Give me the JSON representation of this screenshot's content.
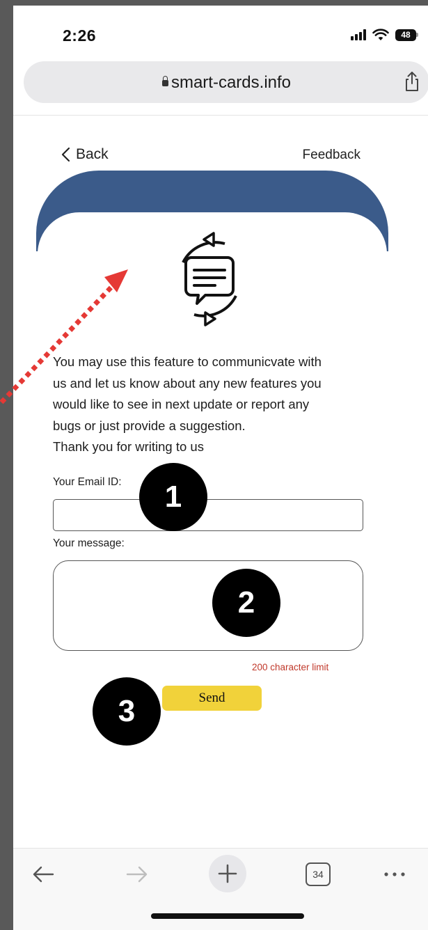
{
  "status_bar": {
    "time": "2:26",
    "battery": "48"
  },
  "browser": {
    "url": "smart-cards.info",
    "tab_count": "34"
  },
  "page": {
    "back_label": "Back",
    "title": "Feedback",
    "banner_color": "#3b5b8a",
    "intro_lines": [
      "You may use this feature to communicvate with",
      "us and let us know about any new features you",
      "would like to see in next update or report any",
      "bugs or just provide a suggestion.",
      "Thank you for writing to us"
    ],
    "email_label": "Your Email ID:",
    "email_value": "",
    "message_label": "Your message:",
    "message_value": "",
    "char_limit": "200 character limit",
    "send_label": "Send",
    "send_color": "#f1d23a"
  },
  "annotations": {
    "badges": [
      "1",
      "2",
      "3"
    ],
    "arrow_color": "#e53935"
  }
}
